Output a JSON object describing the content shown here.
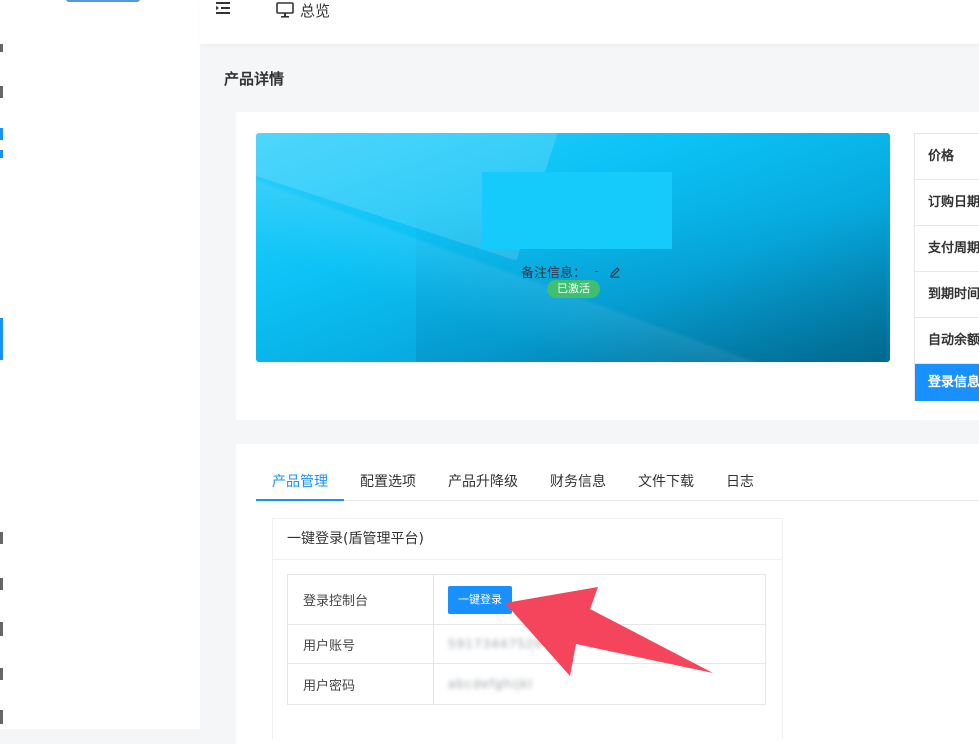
{
  "topbar": {
    "overview_label": "总览"
  },
  "page": {
    "title": "产品详情"
  },
  "product": {
    "remark_label": "备注信息：",
    "remark_value": "-",
    "status": "已激活",
    "status_color": "#3fbf6f"
  },
  "info_table": {
    "rows": [
      "价格",
      "订购日期",
      "支付周期",
      "到期时间",
      "自动余额"
    ],
    "login_label": "登录信息"
  },
  "tabs": [
    "产品管理",
    "配置选项",
    "产品升降级",
    "财务信息",
    "文件下载",
    "日志"
  ],
  "active_tab": "产品管理",
  "one_click": {
    "header": "一键登录(盾管理平台)",
    "console_label": "登录控制台",
    "login_button": "一键登录",
    "account_label": "用户账号",
    "account_value": "59173447520",
    "password_label": "用户密码",
    "password_value": "abcdefghijkl"
  },
  "colors": {
    "accent": "#1890ff",
    "annotation": "#f5455c"
  }
}
